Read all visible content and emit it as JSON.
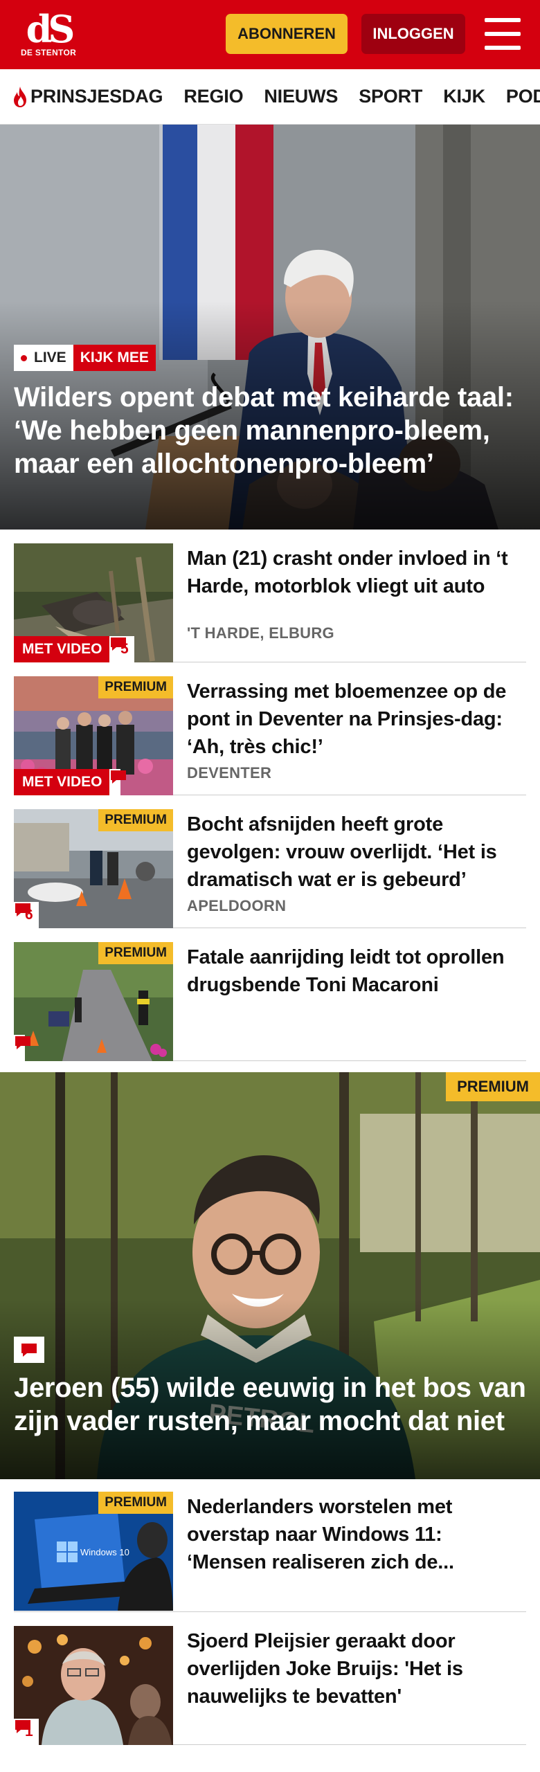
{
  "header": {
    "logo_mark": "dS",
    "logo_sub": "DE STENTOR",
    "subscribe_label": "ABONNEREN",
    "login_label": "INLOGGEN",
    "brand_color": "#d4000f",
    "accent_color": "#f4bc2a"
  },
  "nav": {
    "items": [
      {
        "label": "PRINSJESDAG",
        "icon": "flame-icon"
      },
      {
        "label": "REGIO"
      },
      {
        "label": "NIEUWS"
      },
      {
        "label": "SPORT"
      },
      {
        "label": "KIJK"
      },
      {
        "label": "PODCA"
      }
    ]
  },
  "hero": {
    "live_label": "LIVE",
    "watch_label": "KIJK MEE",
    "title": "Wilders opent debat met keiharde taal: ‘We hebben geen mannenpro-bleem, maar een allochtonenpro-bleem’"
  },
  "articles": [
    {
      "title": "Man (21) crasht onder invloed in ‘t Harde, motorblok vliegt uit auto",
      "location": "'T HARDE, ELBURG",
      "video_label": "MET VIDEO",
      "comments": "5",
      "premium": ""
    },
    {
      "title": "Verrassing met bloemenzee op de pont in Deventer na Prinsjes-dag: ‘Ah, très chic!’",
      "location": "DEVENTER",
      "video_label": "MET VIDEO",
      "comments": "",
      "premium": "PREMIUM"
    },
    {
      "title": "Bocht afsnijden heeft grote gevolgen: vrouw overlijdt. ‘Het is dramatisch wat er is gebeurd’",
      "location": "APELDOORN",
      "comments": "6",
      "premium": "PREMIUM"
    },
    {
      "title": "Fatale aanrijding leidt tot oprollen drugsbende Toni Macaroni",
      "location": "",
      "comments": "",
      "premium": "PREMIUM"
    }
  ],
  "feature": {
    "premium": "PREMIUM",
    "title": "Jeroen (55) wilde eeuwig in het bos van zijn vader rusten, maar mocht dat niet"
  },
  "articles2": [
    {
      "title": "Nederlanders worstelen met overstap naar Windows 11: ‘Mensen realiseren zich de...",
      "premium": "PREMIUM",
      "thumb_text": "Windows 10"
    },
    {
      "title": "Sjoerd Pleijsier geraakt door overlijden Joke Bruijs: 'Het is nauwelijks te bevatten'",
      "comments": "1"
    }
  ]
}
